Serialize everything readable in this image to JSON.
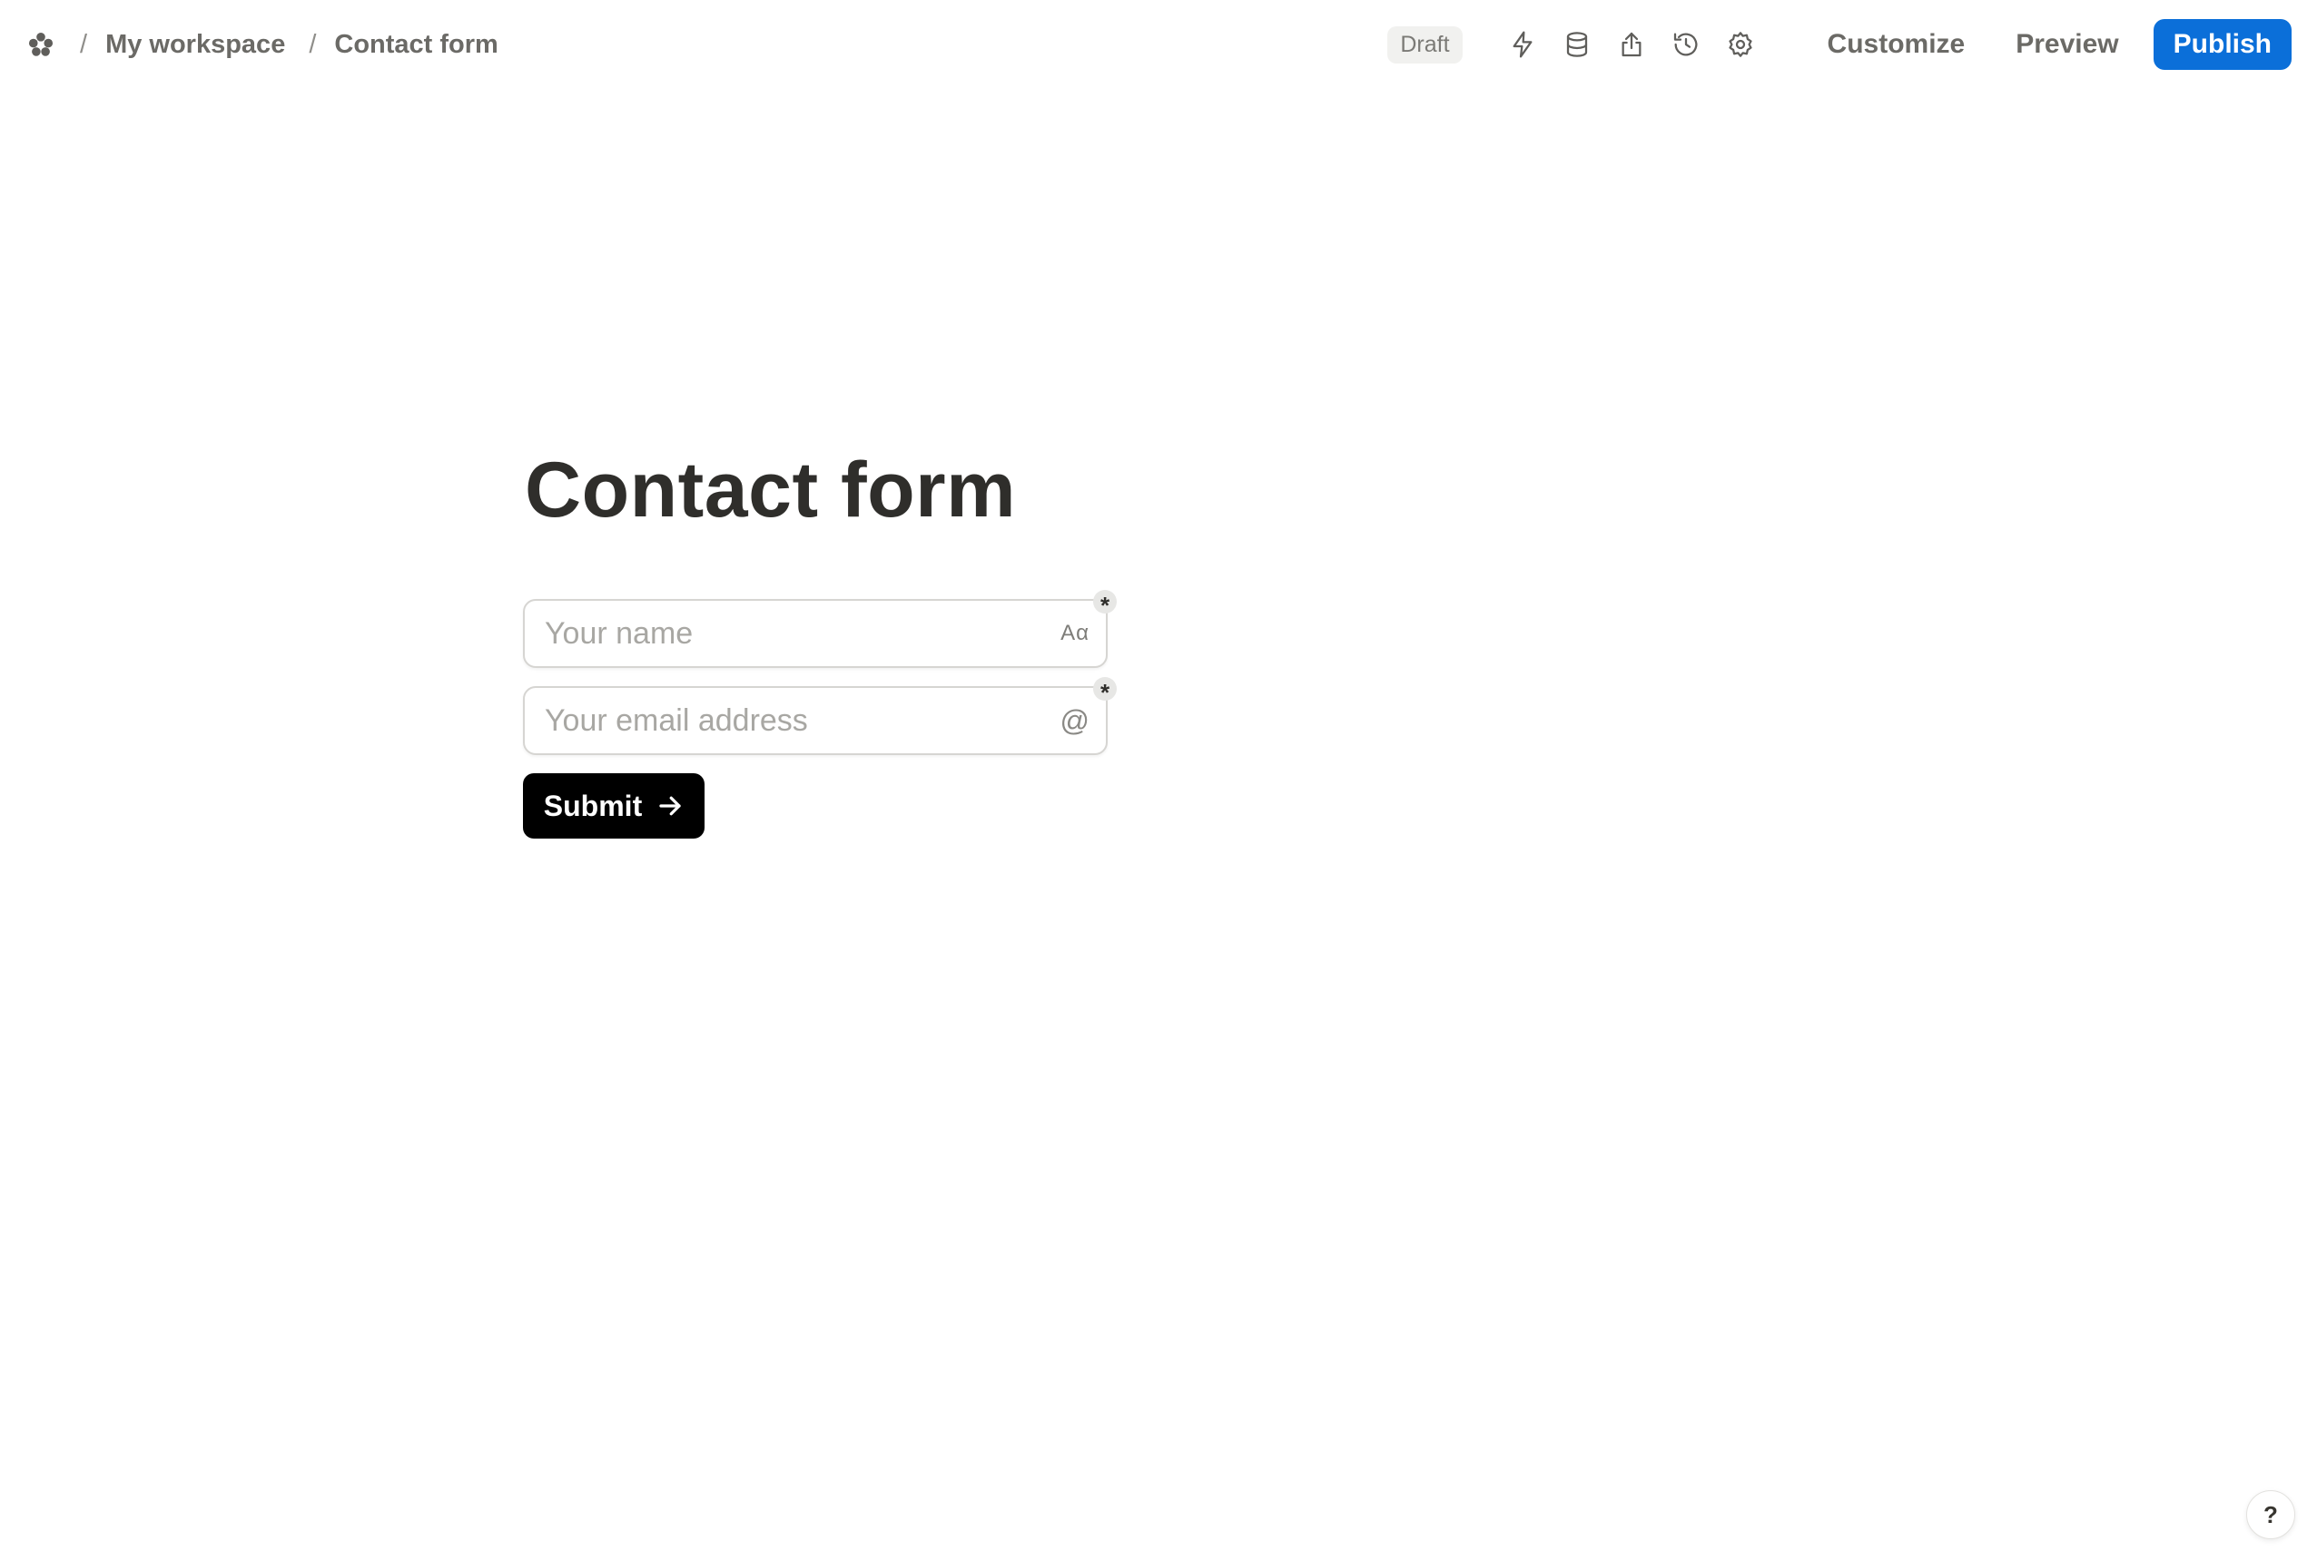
{
  "breadcrumb": {
    "workspace": "My workspace",
    "page": "Contact form",
    "separator": "/"
  },
  "toolbar": {
    "status_badge": "Draft",
    "icons": [
      "lightning-icon",
      "database-icon",
      "share-icon",
      "history-icon",
      "settings-icon"
    ],
    "customize_label": "Customize",
    "preview_label": "Preview",
    "publish_label": "Publish"
  },
  "form": {
    "title": "Contact form",
    "fields": [
      {
        "placeholder": "Your name",
        "value": "",
        "type_icon": "Aα",
        "required": true,
        "required_mark": "*"
      },
      {
        "placeholder": "Your email address",
        "value": "",
        "type_icon": "@",
        "required": true,
        "required_mark": "*"
      }
    ],
    "submit_label": "Submit"
  },
  "help": {
    "label": "?"
  },
  "colors": {
    "publish_bg": "#0b6fd9",
    "submit_bg": "#000000",
    "title_text": "#2f2e2b",
    "muted_text": "#6b6a66"
  }
}
